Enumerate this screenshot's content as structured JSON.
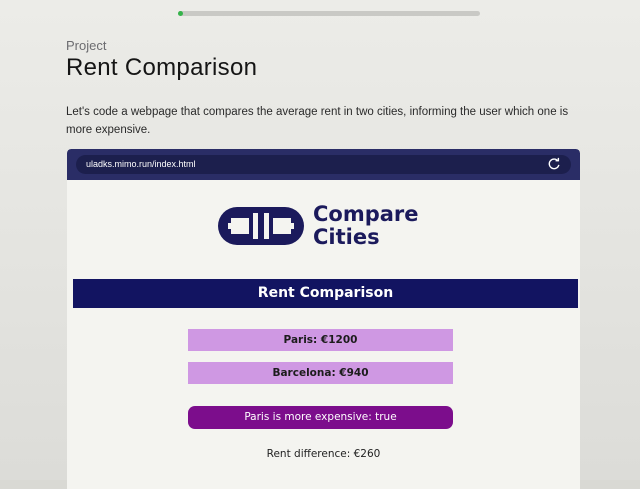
{
  "lesson": {
    "progress_fraction": 0.01,
    "project_label": "Project",
    "title": "Rent Comparison",
    "description": "Let's code a webpage that compares the average rent in two cities, informing the user which one is more expensive."
  },
  "browser": {
    "url": "uladks.mimo.run/index.html",
    "reload_icon": "reload-icon"
  },
  "page": {
    "logo": {
      "line1": "Compare",
      "line2": "Cities",
      "icon": "bridge-logo-icon"
    },
    "banner": "Rent Comparison",
    "cities": [
      {
        "text": "Paris: €1200"
      },
      {
        "text": "Barcelona: €940"
      }
    ],
    "result": "Paris is more expensive: true",
    "difference": "Rent difference: €260"
  },
  "colors": {
    "progress": "#35b34a",
    "browser_bar": "#2a2d66",
    "brand_navy": "#121461",
    "city_box": "#cf98e3",
    "result_pill": "#7c0d8c"
  }
}
